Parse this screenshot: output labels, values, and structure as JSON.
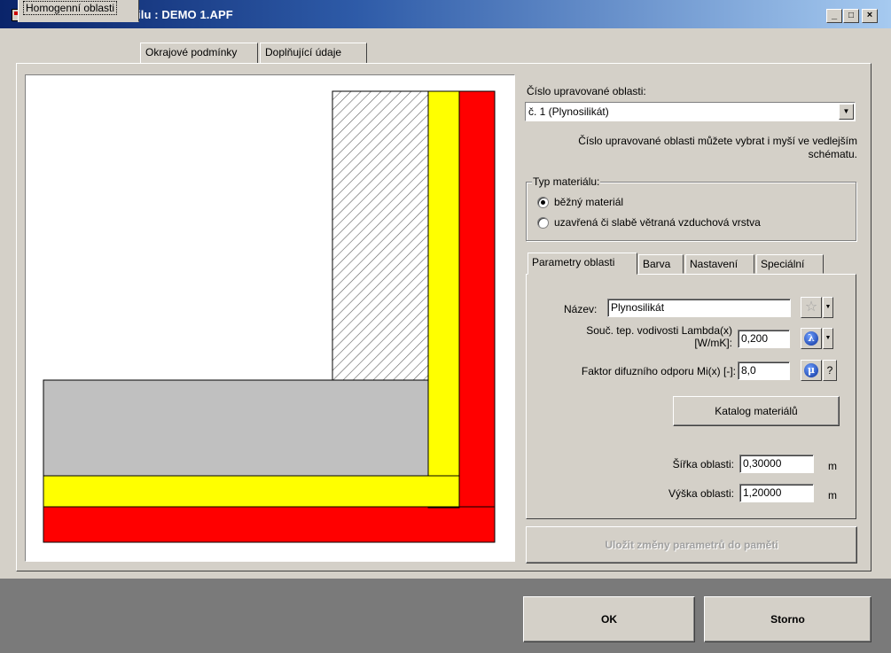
{
  "window": {
    "title": "Rychlá úprava detailu : DEMO 1.APF",
    "min": "_",
    "max": "□",
    "close": "×"
  },
  "tabs": [
    {
      "label": "Homogenní oblasti"
    },
    {
      "label": "Okrajové podmínky"
    },
    {
      "label": "Doplňující údaje"
    }
  ],
  "region": {
    "label": "Číslo upravované oblasti:",
    "selected": "č. 1  (Plynosilikát)",
    "hint_line1": "Číslo upravované oblasti můžete vybrat i myší ve vedlejším",
    "hint_line2": "schématu."
  },
  "material_type": {
    "legend": "Typ materiálu:",
    "options": [
      "běžný materiál",
      "uzavřená či slabě větraná vzduchová vrstva"
    ],
    "selected": 0
  },
  "subtabs": [
    {
      "label": "Parametry oblasti"
    },
    {
      "label": "Barva"
    },
    {
      "label": "Nastavení"
    },
    {
      "label": "Speciální"
    }
  ],
  "params": {
    "name_label": "Název:",
    "name_value": "Plynosilikát",
    "lambda_label1": "Souč. tep. vodivosti  Lambda(x)",
    "lambda_label2": "[W/mK]:",
    "lambda_value": "0,200",
    "lambda_icon": "λ",
    "mi_label": "Faktor difuzního odporu  Mi(x) [-]:",
    "mi_value": "8,0",
    "mi_icon": "μ",
    "help": "?",
    "catalog_button": "Katalog materiálů",
    "width_label": "Šířka oblasti:",
    "width_value": "0,30000",
    "width_unit": "m",
    "height_label": "Výška oblasti:",
    "height_value": "1,20000",
    "height_unit": "m"
  },
  "save_button": "Uložit změny parametrů do paměti",
  "ok_button": "OK",
  "cancel_button": "Storno",
  "colors": {
    "red": "#ff0000",
    "yellow": "#ffff00",
    "gray": "#c0c0c0",
    "hatch": "#a0a0a0"
  }
}
